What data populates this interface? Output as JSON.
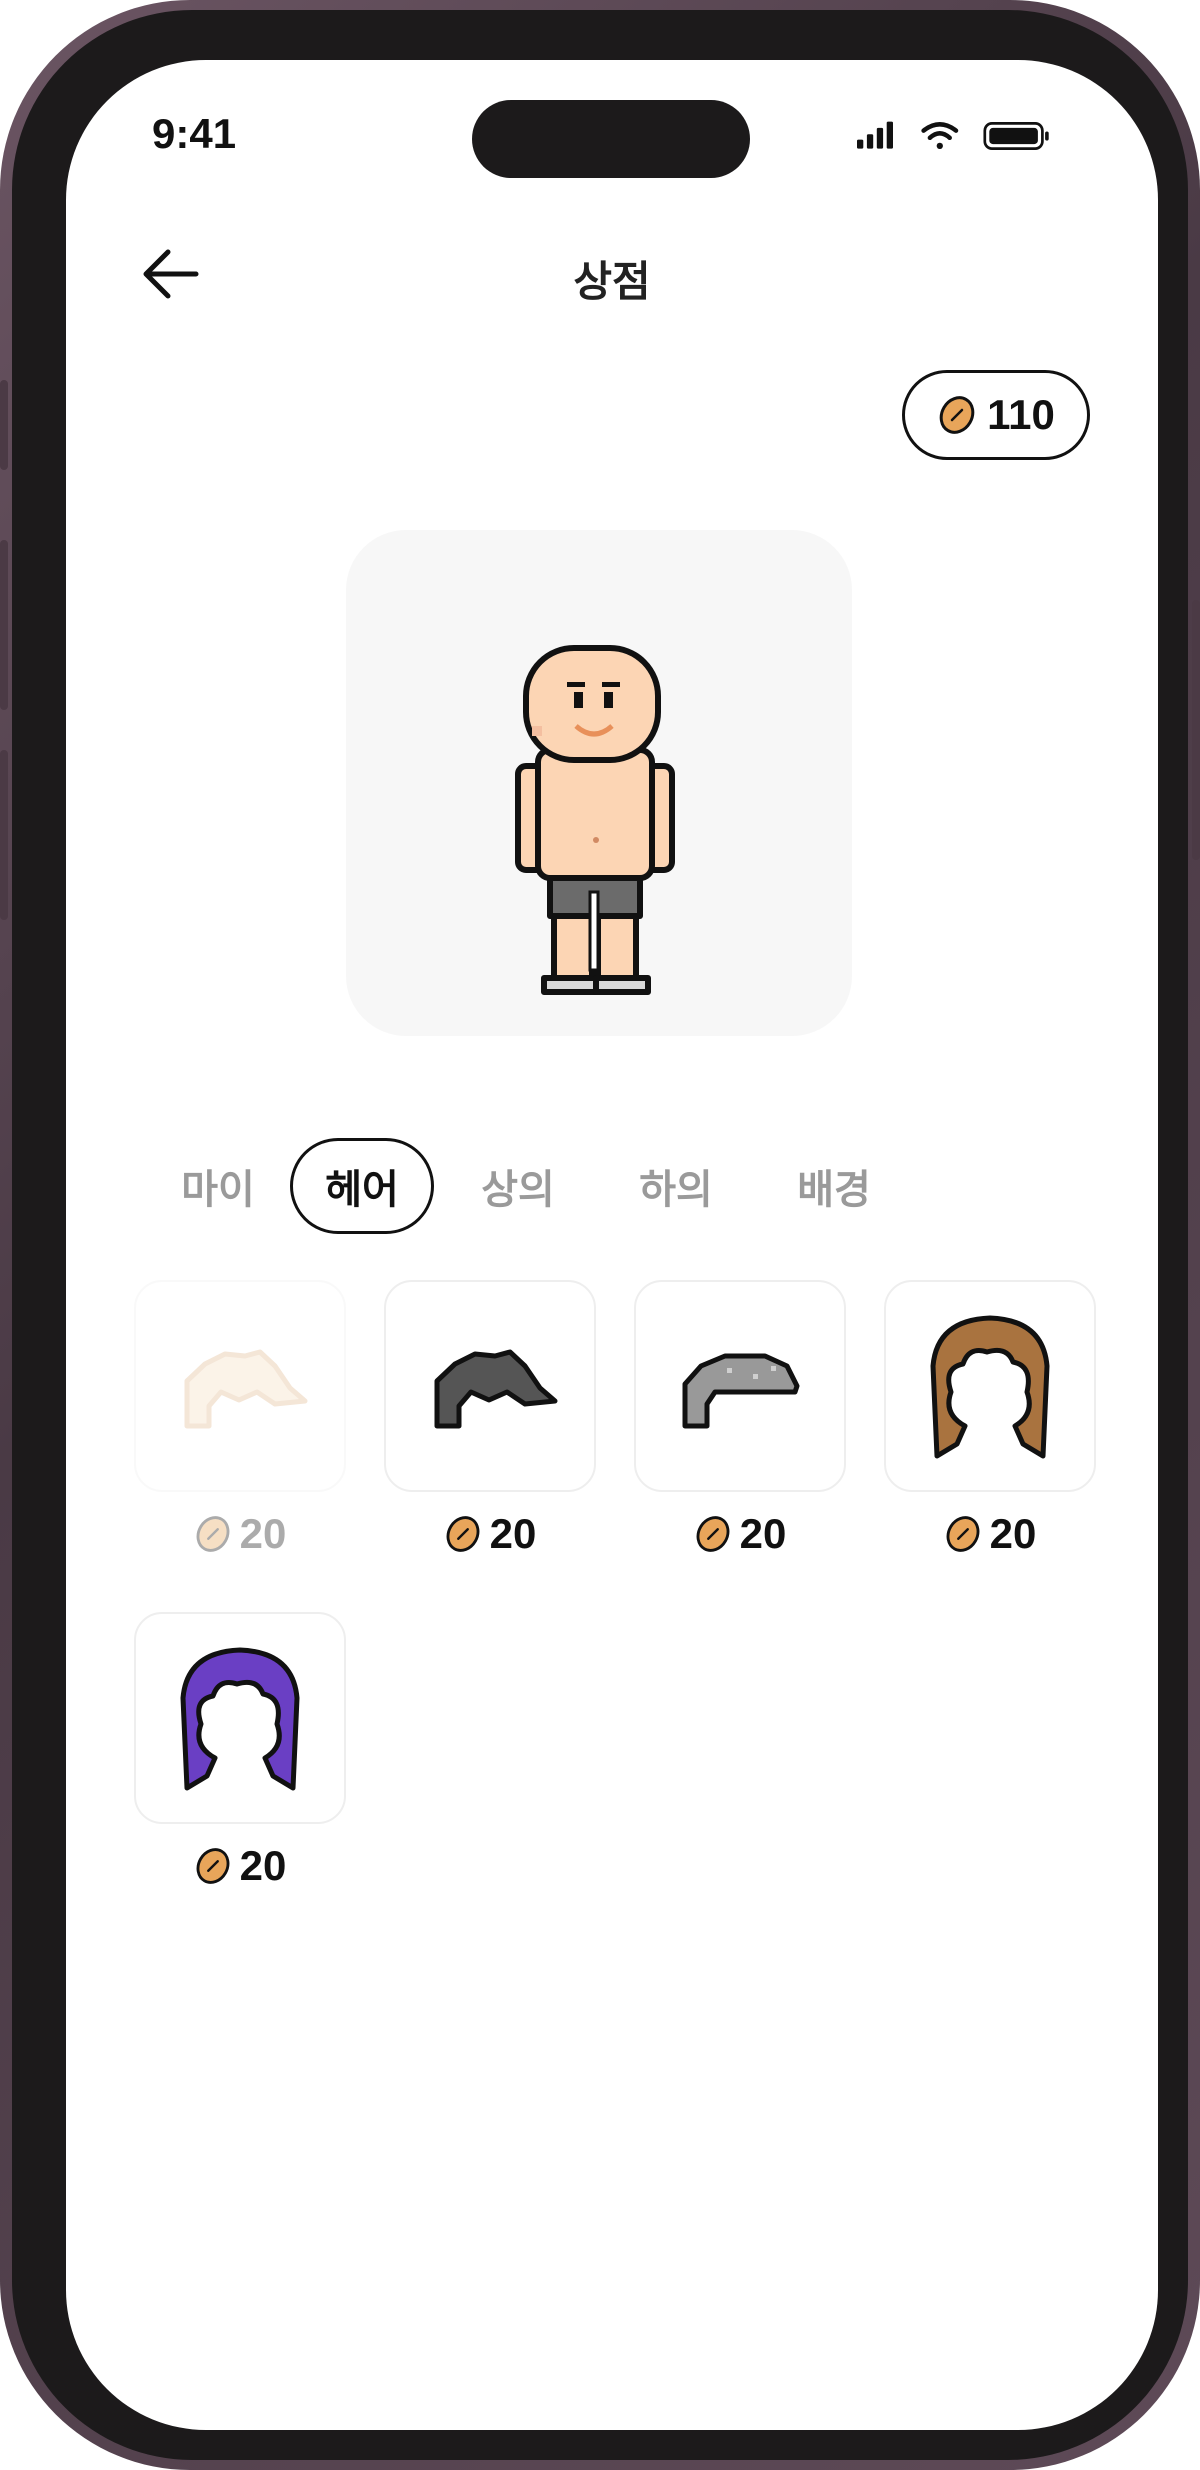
{
  "status_bar": {
    "time": "9:41"
  },
  "header": {
    "title": "상점"
  },
  "wallet": {
    "coins": "110"
  },
  "tabs": [
    {
      "label": "마이",
      "active": false
    },
    {
      "label": "헤어",
      "active": true
    },
    {
      "label": "상의",
      "active": false
    },
    {
      "label": "하의",
      "active": false
    },
    {
      "label": "배경",
      "active": false
    }
  ],
  "items": [
    {
      "price": "20",
      "color": "#f6ddc0",
      "style": "short-spiky",
      "owned_disabled": true
    },
    {
      "price": "20",
      "color": "#555555",
      "style": "short-spiky",
      "owned_disabled": false
    },
    {
      "price": "20",
      "color": "#999999",
      "style": "short-swept",
      "owned_disabled": false
    },
    {
      "price": "20",
      "color": "#a9733f",
      "style": "long-bob",
      "owned_disabled": false
    },
    {
      "price": "20",
      "color": "#6a3fc4",
      "style": "long-bob",
      "owned_disabled": false
    }
  ],
  "colors": {
    "coin": "#e8a55a",
    "skin": "#fcd5b4",
    "shorts": "#6b6b6b"
  }
}
